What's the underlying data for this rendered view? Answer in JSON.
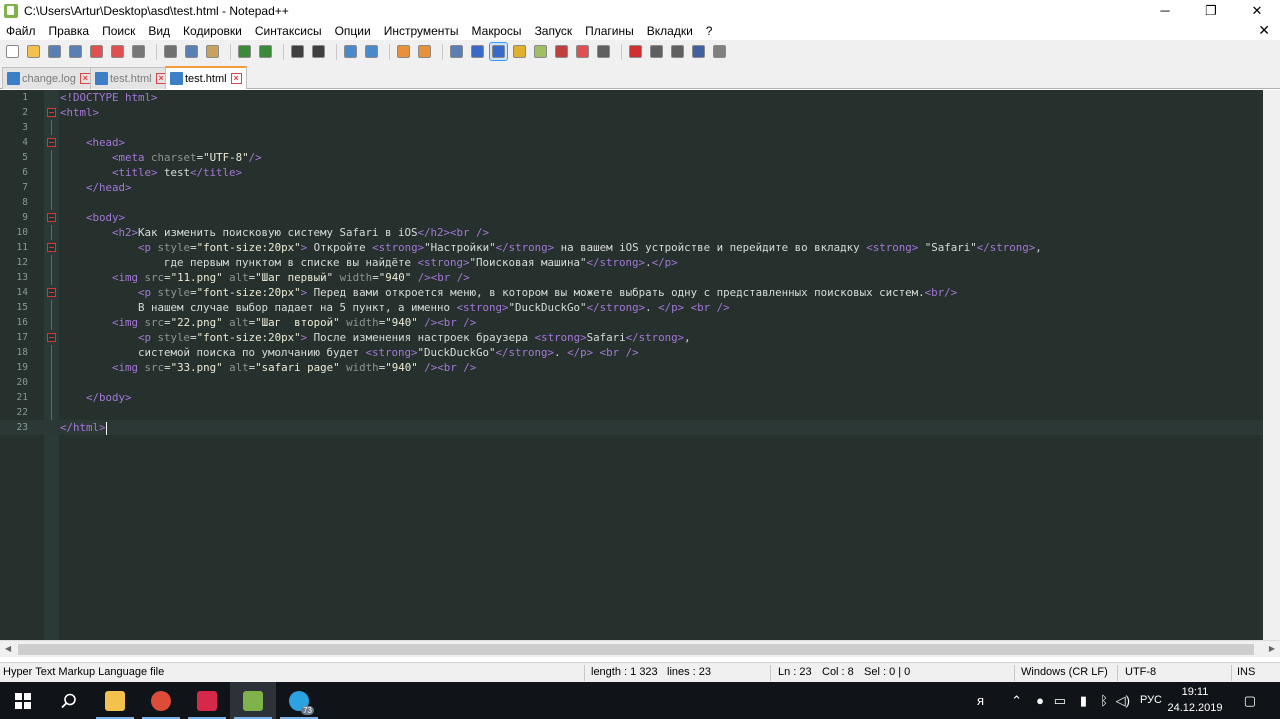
{
  "window": {
    "title": "C:\\Users\\Artur\\Desktop\\asd\\test.html - Notepad++",
    "minimize_glyph": "─",
    "maximize_glyph": "❐",
    "close_glyph": "✕"
  },
  "menu": {
    "items": [
      "Файл",
      "Правка",
      "Поиск",
      "Вид",
      "Кодировки",
      "Синтаксисы",
      "Опции",
      "Инструменты",
      "Макросы",
      "Запуск",
      "Плагины",
      "Вкладки",
      "?"
    ],
    "close_glyph": "✕"
  },
  "toolbar": {
    "buttons": [
      {
        "name": "new-file",
        "color": "#ffffff"
      },
      {
        "name": "open-file",
        "color": "#f2c14e"
      },
      {
        "name": "save",
        "color": "#5a7fb5"
      },
      {
        "name": "save-all",
        "color": "#5a7fb5"
      },
      {
        "name": "close",
        "color": "#e05050"
      },
      {
        "name": "close-all",
        "color": "#e05050"
      },
      {
        "name": "print",
        "color": "#777777"
      },
      {
        "sep": true
      },
      {
        "name": "cut",
        "color": "#707070"
      },
      {
        "name": "copy",
        "color": "#5a7fb5"
      },
      {
        "name": "paste",
        "color": "#c8a060"
      },
      {
        "sep": true
      },
      {
        "name": "undo",
        "color": "#3a8a3a"
      },
      {
        "name": "redo",
        "color": "#3a8a3a"
      },
      {
        "sep": true
      },
      {
        "name": "find",
        "color": "#404040"
      },
      {
        "name": "replace",
        "color": "#404040"
      },
      {
        "sep": true
      },
      {
        "name": "zoom-in",
        "color": "#4a8acc"
      },
      {
        "name": "zoom-out",
        "color": "#4a8acc"
      },
      {
        "sep": true
      },
      {
        "name": "sync-vertical",
        "color": "#e8903a"
      },
      {
        "name": "sync-horizontal",
        "color": "#e8903a"
      },
      {
        "sep": true
      },
      {
        "name": "word-wrap",
        "color": "#5a7fb5"
      },
      {
        "name": "show-all-chars",
        "color": "#3a6ac8"
      },
      {
        "name": "indent-guide",
        "color": "#3a6ac8",
        "active": true
      },
      {
        "name": "user-language",
        "color": "#e0b030"
      },
      {
        "name": "doc-map",
        "color": "#a0c060"
      },
      {
        "name": "function-list",
        "color": "#c04040"
      },
      {
        "name": "folder-workspace",
        "color": "#e05050"
      },
      {
        "name": "monitoring",
        "color": "#606060"
      },
      {
        "sep": true
      },
      {
        "name": "record-macro",
        "color": "#d03030"
      },
      {
        "name": "stop-record",
        "color": "#606060"
      },
      {
        "name": "play-macro",
        "color": "#606060"
      },
      {
        "name": "run-macro-multiple",
        "color": "#4060a0"
      },
      {
        "name": "save-macro",
        "color": "#808080"
      }
    ]
  },
  "tabs": [
    {
      "label": "change.log",
      "active": false
    },
    {
      "label": "test.html",
      "active": false
    },
    {
      "label": "test.html",
      "active": true
    }
  ],
  "editor": {
    "lines": [
      {
        "n": "1",
        "fold": "none",
        "html": "<span class='t'>&lt;!DOCTYPE html&gt;</span>"
      },
      {
        "n": "2",
        "fold": "box",
        "html": "<span class='t'>&lt;html&gt;</span>"
      },
      {
        "n": "3",
        "fold": "line",
        "html": ""
      },
      {
        "n": "4",
        "fold": "box",
        "html": "    <span class='t'>&lt;head&gt;</span>"
      },
      {
        "n": "5",
        "fold": "line",
        "html": "        <span class='t'>&lt;meta</span> <span class='a'>charset</span>=<span class='s'>\"UTF-8\"</span><span class='t'>/&gt;</span>"
      },
      {
        "n": "6",
        "fold": "line",
        "html": "        <span class='t'>&lt;title&gt;</span> test<span class='t'>&lt;/title&gt;</span>"
      },
      {
        "n": "7",
        "fold": "line",
        "html": "    <span class='t'>&lt;/head&gt;</span>"
      },
      {
        "n": "8",
        "fold": "line",
        "html": ""
      },
      {
        "n": "9",
        "fold": "box",
        "html": "    <span class='t'>&lt;body&gt;</span>"
      },
      {
        "n": "10",
        "fold": "line",
        "html": "        <span class='t'>&lt;h2&gt;</span>Как изменить поисковую систему Safari в iOS<span class='t'>&lt;/h2&gt;&lt;br /&gt;</span>"
      },
      {
        "n": "11",
        "fold": "box",
        "html": "            <span class='t'>&lt;p</span> <span class='a'>style</span>=<span class='s'>\"font-size:20px\"</span><span class='t'>&gt;</span> Откройте <span class='t'>&lt;strong&gt;</span>\"Настройки\"<span class='t'>&lt;/strong&gt;</span> на вашем iOS устройстве и перейдите во вкладку <span class='t'>&lt;strong&gt;</span> \"Safari\"<span class='t'>&lt;/strong&gt;</span>,"
      },
      {
        "n": "12",
        "fold": "line",
        "html": "                где первым пунктом в списке вы найдёте <span class='t'>&lt;strong&gt;</span>\"Поисковая машина\"<span class='t'>&lt;/strong&gt;</span>.<span class='t'>&lt;/p&gt;</span>"
      },
      {
        "n": "13",
        "fold": "line",
        "html": "        <span class='t'>&lt;img</span> <span class='a'>src</span>=<span class='s'>\"11.png\"</span> <span class='a'>alt</span>=<span class='s'>\"Шаг первый\"</span> <span class='a'>width</span>=<span class='s'>\"940\"</span> <span class='t'>/&gt;&lt;br /&gt;</span>"
      },
      {
        "n": "14",
        "fold": "box",
        "html": "            <span class='t'>&lt;p</span> <span class='a'>style</span>=<span class='s'>\"font-size:20px\"</span><span class='t'>&gt;</span> Перед вами откроется меню, в котором вы можете выбрать одну с представленных поисковых систем.<span class='t'>&lt;br/&gt;</span>"
      },
      {
        "n": "15",
        "fold": "line",
        "html": "            В нашем случае выбор падает на 5 пункт, а именно <span class='t'>&lt;strong&gt;</span>\"DuckDuckGo\"<span class='t'>&lt;/strong&gt;</span>. <span class='t'>&lt;/p&gt;</span> <span class='t'>&lt;br /&gt;</span>"
      },
      {
        "n": "16",
        "fold": "line",
        "html": "        <span class='t'>&lt;img</span> <span class='a'>src</span>=<span class='s'>\"22.png\"</span> <span class='a'>alt</span>=<span class='s'>\"Шаг  второй\"</span> <span class='a'>width</span>=<span class='s'>\"940\"</span> <span class='t'>/&gt;&lt;br /&gt;</span>"
      },
      {
        "n": "17",
        "fold": "box",
        "html": "            <span class='t'>&lt;p</span> <span class='a'>style</span>=<span class='s'>\"font-size:20px\"</span><span class='t'>&gt;</span> После изменения настроек браузера <span class='t'>&lt;strong&gt;</span>Safari<span class='t'>&lt;/strong&gt;</span>,"
      },
      {
        "n": "18",
        "fold": "line",
        "html": "            системой поиска по умолчанию будет <span class='t'>&lt;strong&gt;</span>\"DuckDuckGo\"<span class='t'>&lt;/strong&gt;</span>. <span class='t'>&lt;/p&gt;</span> <span class='t'>&lt;br /&gt;</span>"
      },
      {
        "n": "19",
        "fold": "line",
        "html": "        <span class='t'>&lt;img</span> <span class='a'>src</span>=<span class='s'>\"33.png\"</span> <span class='a'>alt</span>=<span class='s'>\"safari page\"</span> <span class='a'>width</span>=<span class='s'>\"940\"</span> <span class='t'>/&gt;&lt;br /&gt;</span>"
      },
      {
        "n": "20",
        "fold": "line",
        "html": ""
      },
      {
        "n": "21",
        "fold": "line",
        "html": "    <span class='t'>&lt;/body&gt;</span>"
      },
      {
        "n": "22",
        "fold": "line",
        "html": ""
      },
      {
        "n": "23",
        "fold": "none",
        "current": true,
        "html": "<span class='t'>&lt;/html&gt;</span><span id='caret' data-name='text-caret' data-interactable='false'></span>"
      }
    ]
  },
  "status": {
    "language": "Hyper Text Markup Language file",
    "length": "length : 1 323",
    "lines": "lines : 23",
    "ln": "Ln : 23",
    "col": "Col : 8",
    "sel": "Sel : 0 | 0",
    "eol": "Windows (CR LF)",
    "encoding": "UTF-8",
    "mode": "INS"
  },
  "taskbar": {
    "apps": [
      {
        "name": "explorer",
        "color": "#f2c14e",
        "running": true
      },
      {
        "name": "chrome",
        "color": "#dd4b39",
        "running": true
      },
      {
        "name": "jetbrains",
        "color": "#d6284b",
        "running": true
      },
      {
        "name": "notepadpp",
        "color": "#7fb24a",
        "running": true,
        "active": true
      },
      {
        "name": "telegram",
        "color": "#2aa3e0",
        "running": true,
        "badge": "73"
      }
    ],
    "lang": "РУС",
    "time": "19:11",
    "date": "24.12.2019"
  }
}
